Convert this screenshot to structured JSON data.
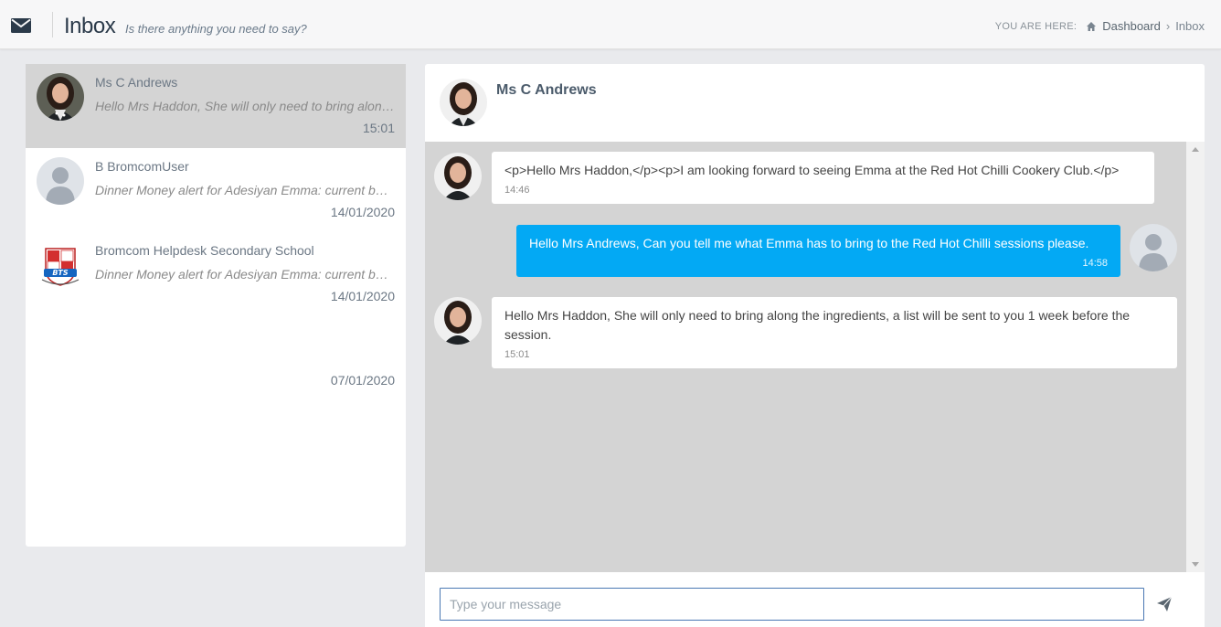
{
  "header": {
    "title": "Inbox",
    "subtitle": "Is there anything you need to say?",
    "breadcrumb_label": "YOU ARE HERE:",
    "breadcrumb_home": "Dashboard",
    "breadcrumb_sep": "›",
    "breadcrumb_current": "Inbox"
  },
  "conversations": [
    {
      "name": "Ms C Andrews",
      "preview": "Hello Mrs Haddon, She will only need to bring along the ingredients, a list will be sent to you 1 week before the session.",
      "time": "15:01",
      "avatar": "woman-photo"
    },
    {
      "name": "B BromcomUser",
      "preview": "Dinner Money alert for Adesiyan Emma: current balance is low",
      "time": "14/01/2020",
      "avatar": "default-user"
    },
    {
      "name": "Bromcom Helpdesk Secondary School",
      "preview": "Dinner Money alert for Adesiyan Emma: current balance is low",
      "time": "14/01/2020",
      "avatar": "school-crest"
    },
    {
      "name": "",
      "preview": "",
      "time": "07/01/2020",
      "avatar": ""
    }
  ],
  "chat": {
    "contact_name": "Ms C Andrews",
    "messages": [
      {
        "direction": "in",
        "text": "<p>Hello Mrs Haddon,</p><p>I am looking forward to seeing Emma at the Red Hot Chilli Cookery Club.</p>",
        "time": "14:46"
      },
      {
        "direction": "out",
        "text": "Hello Mrs Andrews, Can you tell me what Emma has to bring to the Red Hot Chilli sessions please.",
        "time": "14:58"
      },
      {
        "direction": "in",
        "text": "Hello Mrs Haddon, She will only need to bring along the ingredients, a list will be sent to you 1 week before the session.",
        "time": "15:01"
      }
    ],
    "composer_placeholder": "Type your message"
  },
  "colors": {
    "accent": "#03a9f4",
    "header_title": "#2b3a4a",
    "chat_bg": "#d4d4d4"
  }
}
